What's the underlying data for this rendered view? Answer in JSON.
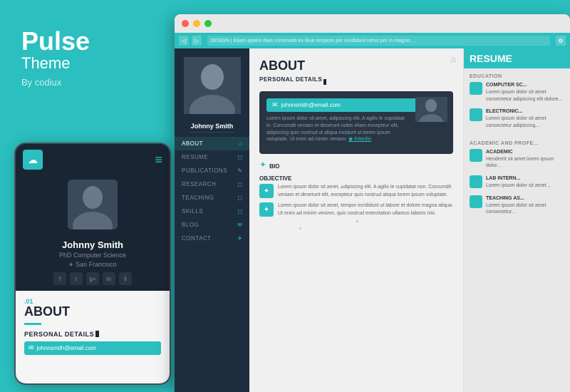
{
  "brand": {
    "title": "Pulse",
    "subtitle": "Theme",
    "by": "By codiux"
  },
  "mobile": {
    "section_num": ".01",
    "section_title": "ABOUT",
    "personal_label": "PERSONAL DETAILS",
    "name": "Johnny Smith",
    "subtitle": "PhD Computer Science",
    "location": "San Francisco",
    "email_placeholder": "johnnsmith@email.com",
    "nav_items": [
      "ABOUT",
      "RESUME",
      "PUBLICATIONS",
      "RESEARCH",
      "TEACHING",
      "SKILLS",
      "BLOG",
      "CONTACT"
    ]
  },
  "desktop": {
    "url": "DESIGN | Etiam aptent diam commodo ex feue tempore per incididunt netus per in magnis ...",
    "section_title": "ABOUT",
    "section_num": "",
    "personal_label": "PERSONAL DETAILS",
    "right_title": "RESUME",
    "education_label": "EDUCATION",
    "academic_label": "ACADEMIC AND PROFE...",
    "nav_items": [
      "ABOUT",
      "RESUME",
      "PUBLICATIONS",
      "RESEARCH",
      "TEACHING",
      "SKILLS",
      "BLOG",
      "CONTACT"
    ],
    "bio_title": "BIO",
    "bio_subtitle": "OBJECTIVE",
    "lorem_short": "Lorem ipsum dolor sit amet adipiscing elit.",
    "resume_items": [
      {
        "title": "COMPUTER SC...",
        "text": "Lorem ipsum dolor sit amet consectetur elit..."
      },
      {
        "title": "ELECTRONIC...",
        "text": "Lorem ipsum dolor sit amet consectetur..."
      },
      {
        "title": "ACADEMIC",
        "text": "Hendrerit sit amet..."
      },
      {
        "title": "LAB INTERN...",
        "text": "Lorem ipsum dolor..."
      },
      {
        "title": "TEACHING AS...",
        "text": "Lorem ipsum dolor..."
      }
    ]
  },
  "icons": {
    "cloud": "☁",
    "menu": "≡",
    "home": "⌂",
    "location": "✈",
    "person": "👤",
    "email": "✉",
    "phone": "📞",
    "facebook": "f",
    "twitter": "t",
    "google": "g",
    "instagram": "in",
    "linkedin": "li"
  },
  "colors": {
    "teal": "#2bbfbf",
    "dark": "#1a2533",
    "sidebar": "#1e2d3d"
  }
}
